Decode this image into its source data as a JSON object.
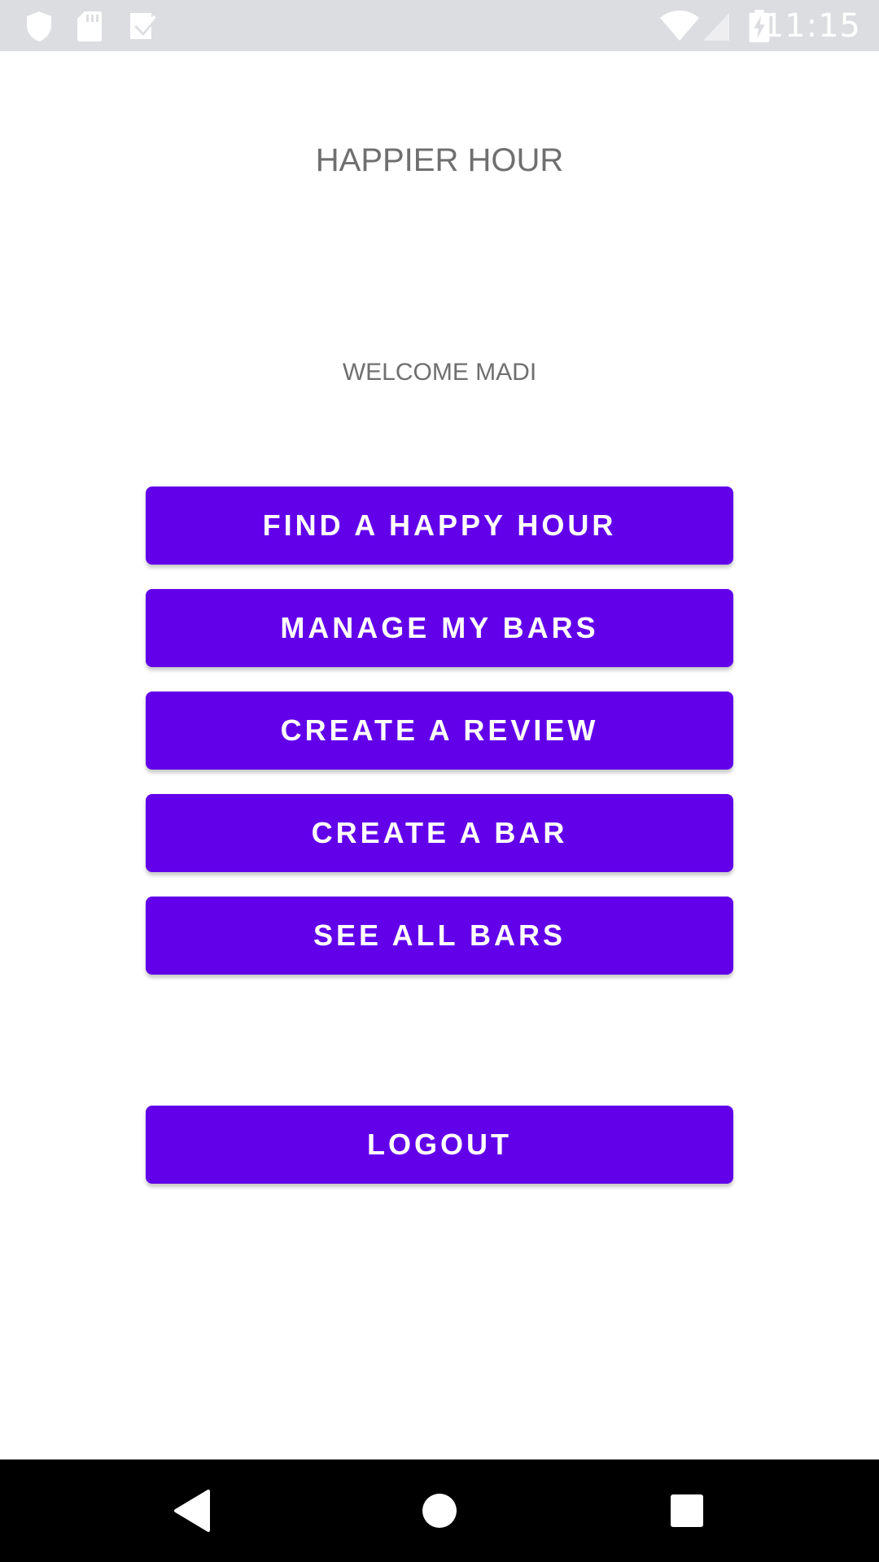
{
  "status_bar": {
    "time": "11:15",
    "icons": [
      "shield-icon",
      "sd-card-icon",
      "task-check-icon",
      "wifi-icon",
      "signal-icon",
      "battery-charging-icon"
    ]
  },
  "app": {
    "title": "HAPPIER HOUR",
    "welcome": "WELCOME MADI"
  },
  "buttons": {
    "find_happy_hour": "FIND A HAPPY HOUR",
    "manage_my_bars": "MANAGE MY BARS",
    "create_review": "CREATE A REVIEW",
    "create_bar": "CREATE A BAR",
    "see_all_bars": "SEE ALL BARS",
    "logout": "LOGOUT"
  },
  "colors": {
    "accent": "#6200ea",
    "status_bar": "#dcdde0",
    "nav_bar": "#000000",
    "text_gray": "#6f6f6f"
  },
  "nav_bar": {
    "icons": [
      "back-icon",
      "home-icon",
      "recents-icon"
    ]
  }
}
